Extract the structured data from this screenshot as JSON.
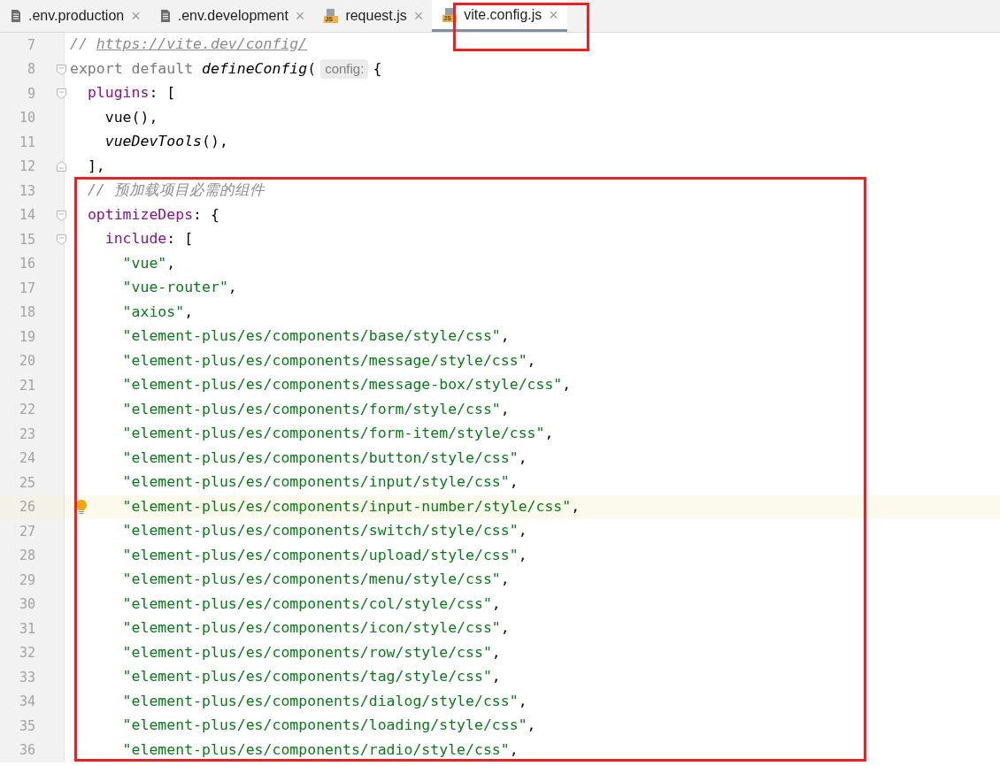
{
  "tabs": [
    {
      "label": ".env.production",
      "kind": "file",
      "selected": false
    },
    {
      "label": ".env.development",
      "kind": "file",
      "selected": false
    },
    {
      "label": "request.js",
      "kind": "js",
      "badge": "JS",
      "selected": false
    },
    {
      "label": "vite.config.js",
      "kind": "js",
      "badge": "JS",
      "selected": true
    }
  ],
  "close_glyph": "×",
  "lines": [
    {
      "number": "7",
      "highlighted": false,
      "tokens": [
        {
          "text": "// ",
          "kind": "comment"
        },
        {
          "text": "https://vite.dev/config/",
          "kind": "link"
        }
      ]
    },
    {
      "number": "8",
      "highlighted": false,
      "kind": "fold_start",
      "tokens": [
        {
          "text": "export default ",
          "kind": "keyword"
        },
        {
          "text": "defineConfig",
          "kind": "function"
        },
        {
          "text": "(",
          "kind": "plain"
        },
        {
          "text": "config:",
          "kind": "hint"
        },
        {
          "text": "{",
          "kind": "plain"
        }
      ]
    },
    {
      "number": "9",
      "highlighted": false,
      "kind": "fold_start",
      "tokens": [
        {
          "text": "  plugins",
          "kind": "property"
        },
        {
          "text": ": [",
          "kind": "plain"
        }
      ]
    },
    {
      "number": "10",
      "highlighted": false,
      "tokens": [
        {
          "text": "    vue(),",
          "kind": "plain"
        }
      ]
    },
    {
      "number": "11",
      "highlighted": false,
      "tokens": [
        {
          "text": "    vueDevTools",
          "kind": "function"
        },
        {
          "text": "(),",
          "kind": "plain"
        }
      ]
    },
    {
      "number": "12",
      "highlighted": false,
      "kind": "fold_end",
      "tokens": [
        {
          "text": "  ],",
          "kind": "plain"
        }
      ]
    },
    {
      "number": "13",
      "highlighted": false,
      "tokens": [
        {
          "text": "  // 预加载项目必需的组件",
          "kind": "comment"
        }
      ]
    },
    {
      "number": "14",
      "highlighted": false,
      "kind": "fold_start",
      "tokens": [
        {
          "text": "  optimizeDeps",
          "kind": "property"
        },
        {
          "text": ": {",
          "kind": "plain"
        }
      ]
    },
    {
      "number": "15",
      "highlighted": false,
      "kind": "fold_start",
      "tokens": [
        {
          "text": "    include",
          "kind": "property"
        },
        {
          "text": ": [",
          "kind": "plain"
        }
      ]
    },
    {
      "number": "16",
      "highlighted": false,
      "tokens": [
        {
          "text": "      \"vue\"",
          "kind": "string"
        },
        {
          "text": ",",
          "kind": "plain"
        }
      ]
    },
    {
      "number": "17",
      "highlighted": false,
      "tokens": [
        {
          "text": "      \"vue-router\"",
          "kind": "string"
        },
        {
          "text": ",",
          "kind": "plain"
        }
      ]
    },
    {
      "number": "18",
      "highlighted": false,
      "tokens": [
        {
          "text": "      \"axios\"",
          "kind": "string"
        },
        {
          "text": ",",
          "kind": "plain"
        }
      ]
    },
    {
      "number": "19",
      "highlighted": false,
      "tokens": [
        {
          "text": "      \"element-plus/es/components/base/style/css\"",
          "kind": "string"
        },
        {
          "text": ",",
          "kind": "plain"
        }
      ]
    },
    {
      "number": "20",
      "highlighted": false,
      "tokens": [
        {
          "text": "      \"element-plus/es/components/message/style/css\"",
          "kind": "string"
        },
        {
          "text": ",",
          "kind": "plain"
        }
      ]
    },
    {
      "number": "21",
      "highlighted": false,
      "tokens": [
        {
          "text": "      \"element-plus/es/components/message-box/style/css\"",
          "kind": "string"
        },
        {
          "text": ",",
          "kind": "plain"
        }
      ]
    },
    {
      "number": "22",
      "highlighted": false,
      "tokens": [
        {
          "text": "      \"element-plus/es/components/form/style/css\"",
          "kind": "string"
        },
        {
          "text": ",",
          "kind": "plain"
        }
      ]
    },
    {
      "number": "23",
      "highlighted": false,
      "tokens": [
        {
          "text": "      \"element-plus/es/components/form-item/style/css\"",
          "kind": "string"
        },
        {
          "text": ",",
          "kind": "plain"
        }
      ]
    },
    {
      "number": "24",
      "highlighted": false,
      "tokens": [
        {
          "text": "      \"element-plus/es/components/button/style/css\"",
          "kind": "string"
        },
        {
          "text": ",",
          "kind": "plain"
        }
      ]
    },
    {
      "number": "25",
      "highlighted": false,
      "tokens": [
        {
          "text": "      \"element-plus/es/components/input/style/css\"",
          "kind": "string"
        },
        {
          "text": ",",
          "kind": "plain"
        }
      ]
    },
    {
      "number": "26",
      "highlighted": true,
      "intention_bulb": true,
      "tokens": [
        {
          "text": "      \"element-plus/es/components/input-number/style/css\"",
          "kind": "string"
        },
        {
          "text": ",",
          "kind": "plain"
        }
      ]
    },
    {
      "number": "27",
      "highlighted": false,
      "tokens": [
        {
          "text": "      \"element-plus/es/components/switch/style/css\"",
          "kind": "string"
        },
        {
          "text": ",",
          "kind": "plain"
        }
      ]
    },
    {
      "number": "28",
      "highlighted": false,
      "tokens": [
        {
          "text": "      \"element-plus/es/components/upload/style/css\"",
          "kind": "string"
        },
        {
          "text": ",",
          "kind": "plain"
        }
      ]
    },
    {
      "number": "29",
      "highlighted": false,
      "tokens": [
        {
          "text": "      \"element-plus/es/components/menu/style/css\"",
          "kind": "string"
        },
        {
          "text": ",",
          "kind": "plain"
        }
      ]
    },
    {
      "number": "30",
      "highlighted": false,
      "tokens": [
        {
          "text": "      \"element-plus/es/components/col/style/css\"",
          "kind": "string"
        },
        {
          "text": ",",
          "kind": "plain"
        }
      ]
    },
    {
      "number": "31",
      "highlighted": false,
      "tokens": [
        {
          "text": "      \"element-plus/es/components/icon/style/css\"",
          "kind": "string"
        },
        {
          "text": ",",
          "kind": "plain"
        }
      ]
    },
    {
      "number": "32",
      "highlighted": false,
      "tokens": [
        {
          "text": "      \"element-plus/es/components/row/style/css\"",
          "kind": "string"
        },
        {
          "text": ",",
          "kind": "plain"
        }
      ]
    },
    {
      "number": "33",
      "highlighted": false,
      "tokens": [
        {
          "text": "      \"element-plus/es/components/tag/style/css\"",
          "kind": "string"
        },
        {
          "text": ",",
          "kind": "plain"
        }
      ]
    },
    {
      "number": "34",
      "highlighted": false,
      "tokens": [
        {
          "text": "      \"element-plus/es/components/dialog/style/css\"",
          "kind": "string"
        },
        {
          "text": ",",
          "kind": "plain"
        }
      ]
    },
    {
      "number": "35",
      "highlighted": false,
      "tokens": [
        {
          "text": "      \"element-plus/es/components/loading/style/css\"",
          "kind": "string"
        },
        {
          "text": ",",
          "kind": "plain"
        }
      ]
    },
    {
      "number": "36",
      "highlighted": false,
      "tokens": [
        {
          "text": "      \"element-plus/es/components/radio/style/css\"",
          "kind": "string"
        },
        {
          "text": ",",
          "kind": "plain"
        }
      ]
    }
  ]
}
